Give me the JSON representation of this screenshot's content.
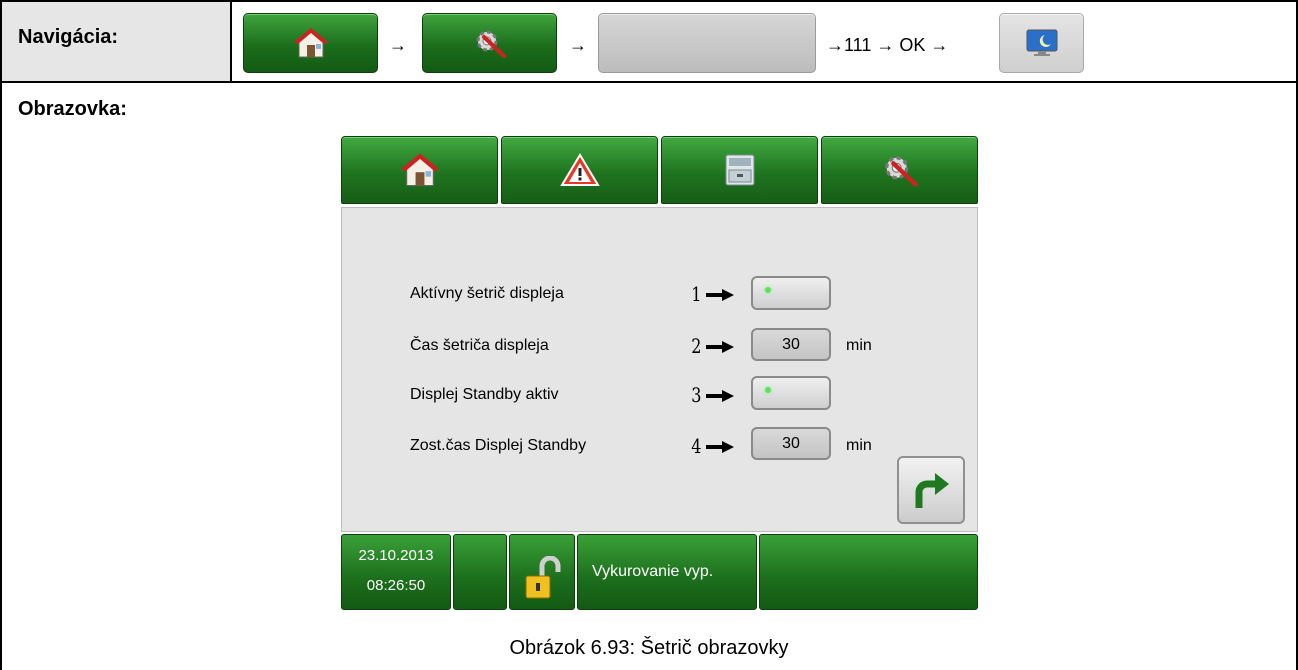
{
  "navigation": {
    "label": "Navigácia:",
    "steps": [
      {
        "type": "button",
        "icon": "home-icon"
      },
      {
        "type": "arrow",
        "text": "→"
      },
      {
        "type": "button",
        "icon": "settings-gear-icon"
      },
      {
        "type": "arrow",
        "text": "→"
      },
      {
        "type": "button",
        "icon": "blank"
      },
      {
        "type": "text",
        "text": "→111 → OK →"
      },
      {
        "type": "button",
        "icon": "monitor-screensaver-icon"
      }
    ],
    "arrow": "→",
    "tail_text": "→111 → OK →"
  },
  "screen": {
    "label": "Obrazovka:",
    "tabs": [
      {
        "icon": "home-icon"
      },
      {
        "icon": "warning-icon"
      },
      {
        "icon": "archive-icon"
      },
      {
        "icon": "settings-gear-icon"
      }
    ],
    "rows": [
      {
        "label": "Aktívny šetrič displeja",
        "number": "1",
        "control": "toggle",
        "led": true
      },
      {
        "label": "Čas šetriča displeja",
        "number": "2",
        "control": "value",
        "value": "30",
        "unit": "min"
      },
      {
        "label": "Displej Standby aktiv",
        "number": "3",
        "control": "toggle",
        "led": true
      },
      {
        "label": "Zost.čas Displej Standby",
        "number": "4",
        "control": "value",
        "value": "30",
        "unit": "min"
      }
    ],
    "status": {
      "date": "23.10.2013",
      "time": "08:26:50",
      "mode": "Vykurovanie vyp."
    }
  },
  "colors": {
    "green_dark": "#1c6e1c",
    "green_light": "#42a941",
    "panel": "#e5e5e5",
    "led": "#5fe05f"
  },
  "caption": "Obrázok 6.93: Šetrič obrazovky"
}
